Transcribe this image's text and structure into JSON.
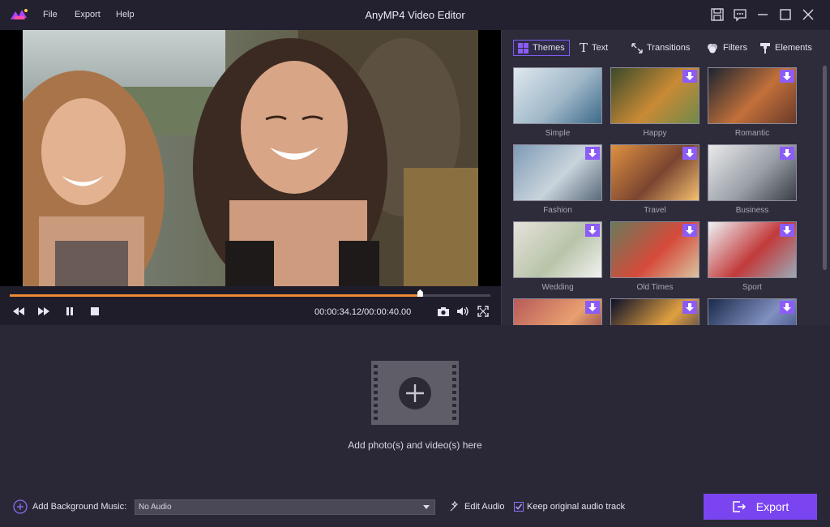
{
  "app": {
    "title": "AnyMP4 Video Editor"
  },
  "menu": {
    "file": "File",
    "export": "Export",
    "help": "Help"
  },
  "icons": {
    "logo": "logo-icon",
    "save": "save-icon",
    "feedback": "feedback-icon",
    "minimize": "minimize-icon",
    "maximize": "maximize-icon",
    "close": "close-icon",
    "rewind": "rewind-icon",
    "forward": "fast-forward-icon",
    "pause": "pause-icon",
    "stop": "stop-icon",
    "snapshot": "camera-icon",
    "volume": "volume-icon",
    "fullscreen": "fullscreen-icon"
  },
  "player": {
    "timecode": "00:00:34.12/00:00:40.00",
    "progress": 0.853
  },
  "panel": {
    "tabs": [
      {
        "label": "Themes",
        "icon": "themes-icon",
        "active": true
      },
      {
        "label": "Text",
        "icon": "text-icon",
        "active": false
      },
      {
        "label": "Transitions",
        "icon": "transitions-icon",
        "active": false
      },
      {
        "label": "Filters",
        "icon": "filters-icon",
        "active": false
      },
      {
        "label": "Elements",
        "icon": "elements-icon",
        "active": false
      }
    ],
    "themes": [
      {
        "label": "Simple",
        "download": false
      },
      {
        "label": "Happy",
        "download": true
      },
      {
        "label": "Romantic",
        "download": true
      },
      {
        "label": "Fashion",
        "download": true
      },
      {
        "label": "Travel",
        "download": true
      },
      {
        "label": "Business",
        "download": true
      },
      {
        "label": "Wedding",
        "download": true
      },
      {
        "label": "Old Times",
        "download": true
      },
      {
        "label": "Sport",
        "download": true
      },
      {
        "label": "",
        "download": true
      },
      {
        "label": "",
        "download": true
      },
      {
        "label": "",
        "download": true
      }
    ]
  },
  "timeline": {
    "drop_text": "Add photo(s) and video(s) here"
  },
  "bottom": {
    "add_music_label": "Add Background Music:",
    "audio_value": "No Audio",
    "edit_audio": "Edit Audio",
    "keep_audio": "Keep original audio track",
    "export": "Export"
  },
  "colors": {
    "accent": "#7a45f0",
    "progress": "#f08a35",
    "background": "#2a2837"
  }
}
